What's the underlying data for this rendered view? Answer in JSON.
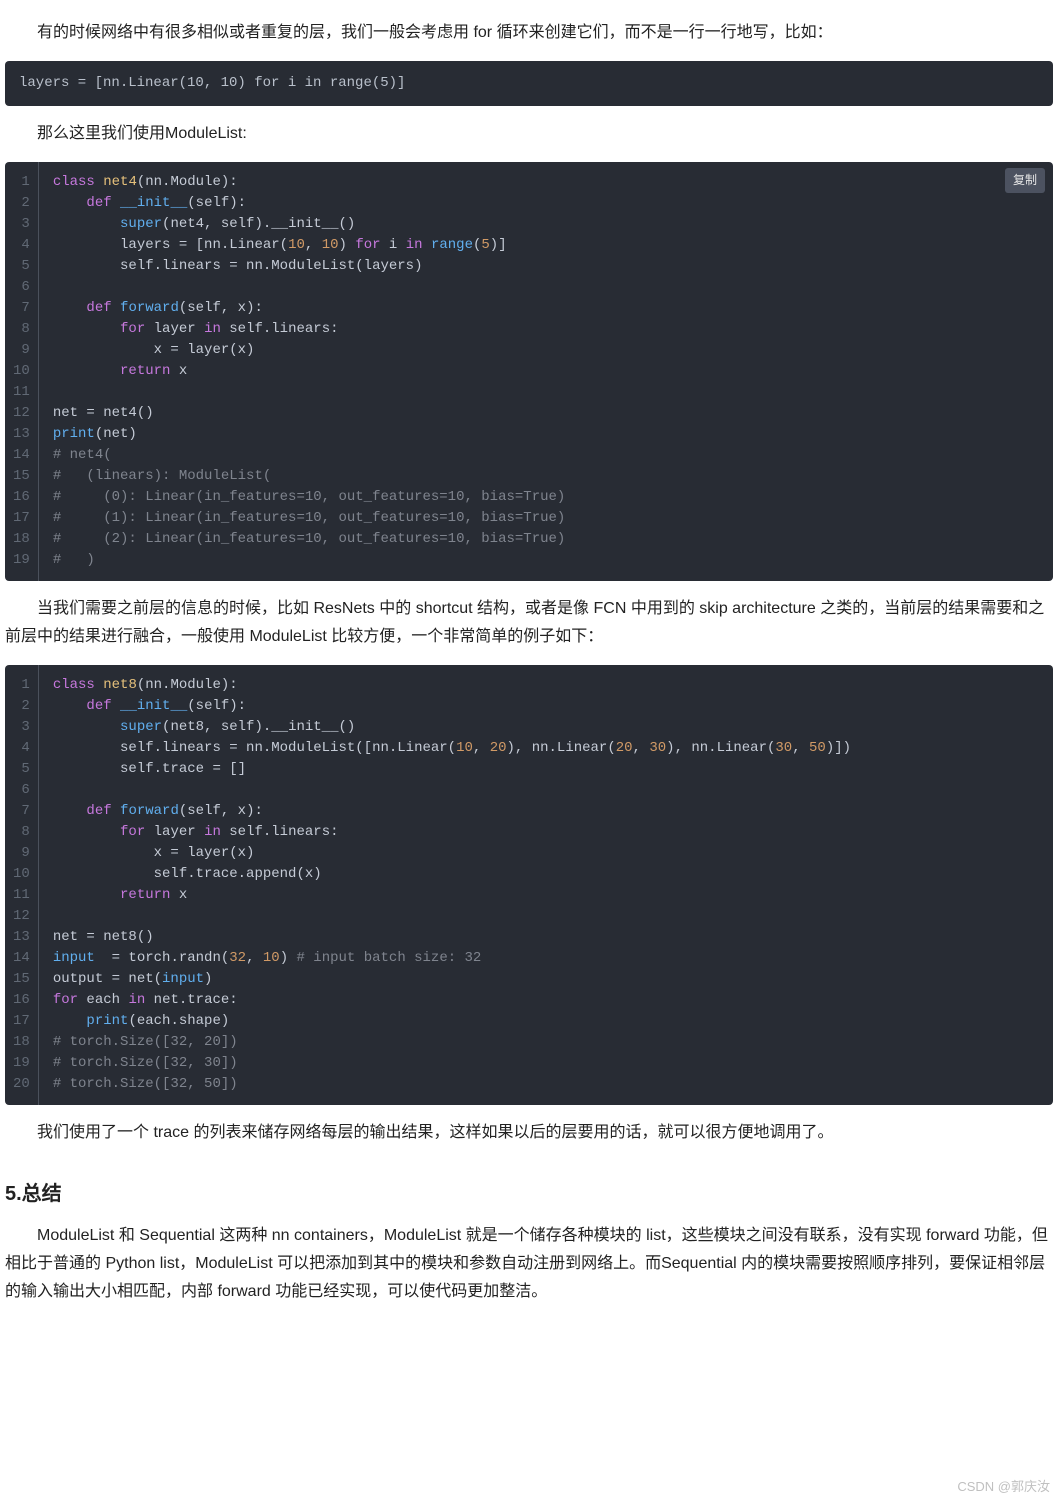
{
  "para1": "有的时候网络中有很多相似或者重复的层，我们一般会考虑用 for 循环来创建它们，而不是一行一行地写，比如：",
  "simple_code": "layers = [nn.Linear(10, 10) for i in range(5)]",
  "para2": "那么这里我们使用ModuleList:",
  "copy_label": "复制",
  "code1": {
    "lines": 19,
    "raw": "class net4(nn.Module):\n    def __init__(self):\n        super(net4, self).__init__()\n        layers = [nn.Linear(10, 10) for i in range(5)]\n        self.linears = nn.ModuleList(layers)\n\n    def forward(self, x):\n        for layer in self.linears:\n            x = layer(x)\n        return x\n\nnet = net4()\nprint(net)\n# net4(\n#   (linears): ModuleList(\n#     (0): Linear(in_features=10, out_features=10, bias=True)\n#     (1): Linear(in_features=10, out_features=10, bias=True)\n#     (2): Linear(in_features=10, out_features=10, bias=True)\n#   )",
    "html": "<span class=\"kw\">class</span> <span class=\"cls\">net4</span>(nn.Module):\n    <span class=\"kw\">def</span> <span class=\"fn\">__init__</span>(self):\n        <span class=\"fn\">super</span>(net4, self).__init__()\n        layers = [nn.Linear(<span class=\"num\">10</span>, <span class=\"num\">10</span>) <span class=\"kw\">for</span> i <span class=\"kw\">in</span> <span class=\"fn\">range</span>(<span class=\"num\">5</span>)]\n        self.linears = nn.ModuleList(layers)\n\n    <span class=\"kw\">def</span> <span class=\"fn\">forward</span>(self, x):\n        <span class=\"kw\">for</span> layer <span class=\"kw\">in</span> self.linears:\n            x = layer(x)\n        <span class=\"kw\">return</span> x\n\nnet = net4()\n<span class=\"fn\">print</span>(net)\n<span class=\"cmt\"># net4(</span>\n<span class=\"cmt\">#   (linears): ModuleList(</span>\n<span class=\"cmt\">#     (0): Linear(in_features=10, out_features=10, bias=True)</span>\n<span class=\"cmt\">#     (1): Linear(in_features=10, out_features=10, bias=True)</span>\n<span class=\"cmt\">#     (2): Linear(in_features=10, out_features=10, bias=True)</span>\n<span class=\"cmt\">#   )</span>"
  },
  "para3": "当我们需要之前层的信息的时候，比如 ResNets 中的 shortcut 结构，或者是像 FCN 中用到的 skip architecture 之类的，当前层的结果需要和之前层中的结果进行融合，一般使用 ModuleList 比较方便，一个非常简单的例子如下：",
  "code2": {
    "lines": 20,
    "raw": "class net8(nn.Module):\n    def __init__(self):\n        super(net8, self).__init__()\n        self.linears = nn.ModuleList([nn.Linear(10, 20), nn.Linear(20, 30), nn.Linear(30, 50)])\n        self.trace = []\n\n    def forward(self, x):\n        for layer in self.linears:\n            x = layer(x)\n            self.trace.append(x)\n        return x\n\nnet = net8()\ninput  = torch.randn(32, 10) # input batch size: 32\noutput = net(input)\nfor each in net.trace:\n    print(each.shape)\n# torch.Size([32, 20])\n# torch.Size([32, 30])\n# torch.Size([32, 50])",
    "html": "<span class=\"kw\">class</span> <span class=\"cls\">net8</span>(nn.Module):\n    <span class=\"kw\">def</span> <span class=\"fn\">__init__</span>(self):\n        <span class=\"fn\">super</span>(net8, self).__init__()\n        self.linears = nn.ModuleList([nn.Linear(<span class=\"num\">10</span>, <span class=\"num\">20</span>), nn.Linear(<span class=\"num\">20</span>, <span class=\"num\">30</span>), nn.Linear(<span class=\"num\">30</span>, <span class=\"num\">50</span>)])\n        self.trace = []\n\n    <span class=\"kw\">def</span> <span class=\"fn\">forward</span>(self, x):\n        <span class=\"kw\">for</span> layer <span class=\"kw\">in</span> self.linears:\n            x = layer(x)\n            self.trace.append(x)\n        <span class=\"kw\">return</span> x\n\nnet = net8()\n<span class=\"fn\">input</span>  = torch.randn(<span class=\"num\">32</span>, <span class=\"num\">10</span>) <span class=\"cmt\"># input batch size: 32</span>\noutput = net(<span class=\"fn\">input</span>)\n<span class=\"kw\">for</span> each <span class=\"kw\">in</span> net.trace:\n    <span class=\"fn\">print</span>(each.shape)\n<span class=\"cmt\"># torch.Size([32, 20])</span>\n<span class=\"cmt\"># torch.Size([32, 30])</span>\n<span class=\"cmt\"># torch.Size([32, 50])</span>"
  },
  "para4": "我们使用了一个 trace 的列表来储存网络每层的输出结果，这样如果以后的层要用的话，就可以很方便地调用了。",
  "section_heading": "5.总结",
  "summary": "ModuleList 和 Sequential 这两种 nn containers，ModuleList 就是一个储存各种模块的 list，这些模块之间没有联系，没有实现 forward 功能，但相比于普通的 Python list，ModuleList 可以把添加到其中的模块和参数自动注册到网络上。而Sequential 内的模块需要按照顺序排列，要保证相邻层的输入输出大小相匹配，内部 forward 功能已经实现，可以使代码更加整洁。",
  "watermark": "CSDN @郭庆汝"
}
